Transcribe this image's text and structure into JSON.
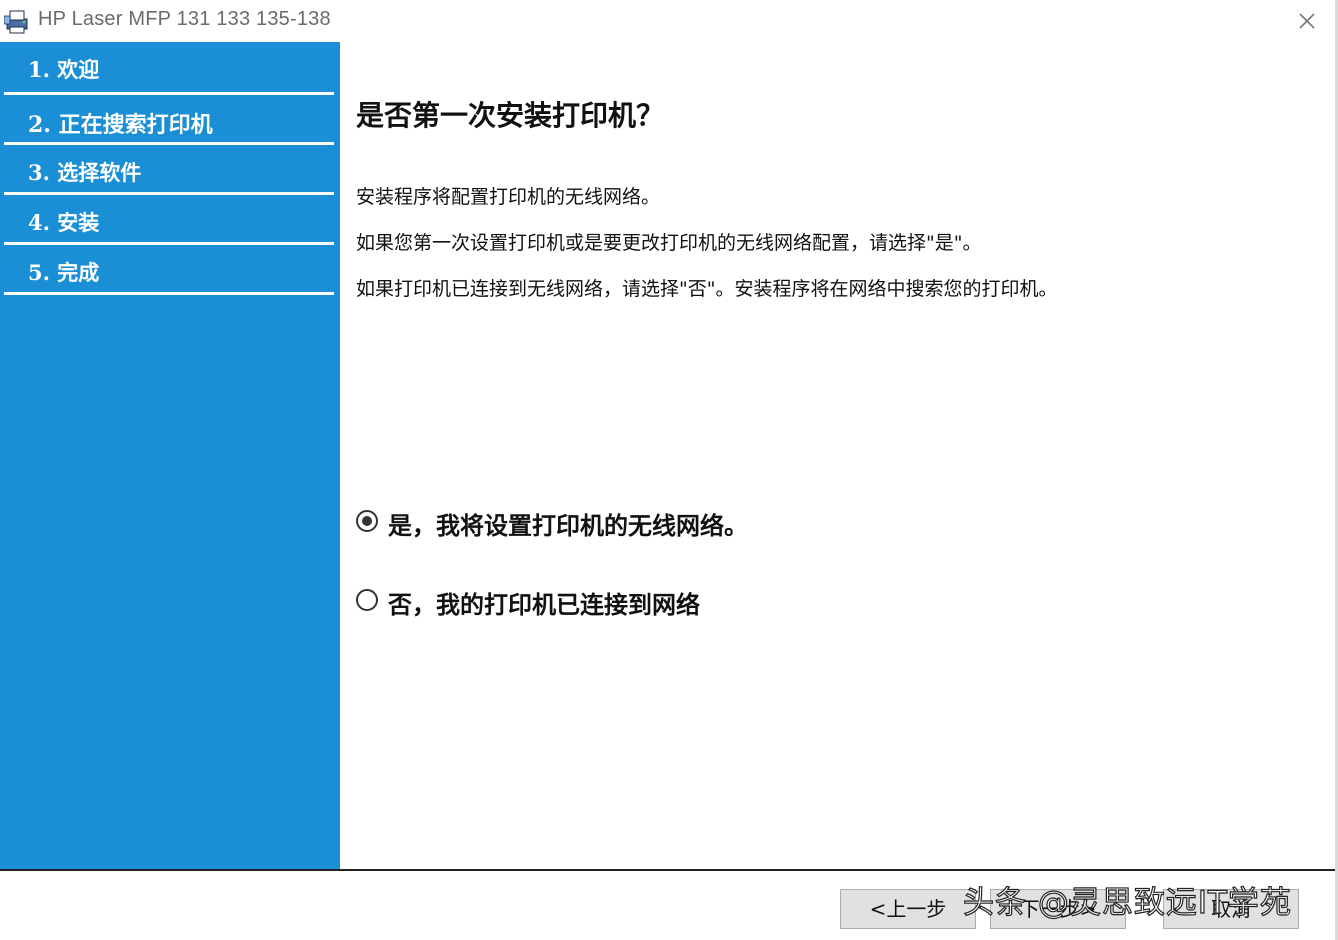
{
  "window": {
    "title": "HP Laser MFP 131 133 135-138"
  },
  "sidebar": {
    "steps": [
      {
        "label": "1. 欢迎"
      },
      {
        "label": "2. 正在搜索打印机"
      },
      {
        "label": "3. 选择软件"
      },
      {
        "label": "4. 安装"
      },
      {
        "label": "5. 完成"
      }
    ],
    "active_index": 1
  },
  "main": {
    "heading": "是否第一次安装打印机？",
    "paragraphs": [
      "安装程序将配置打印机的无线网络。",
      "如果您第一次设置打印机或是要更改打印机的无线网络配置，请选择\"是\"。",
      "如果打印机已连接到无线网络，请选择\"否\"。安装程序将在网络中搜索您的打印机。"
    ],
    "options": [
      {
        "label": "是，我将设置打印机的无线网络。",
        "selected": true
      },
      {
        "label": "否，我的打印机已连接到网络",
        "selected": false
      }
    ]
  },
  "footer": {
    "back_label": "<上一步",
    "next_label": "下一步>",
    "cancel_label": "取消",
    "watermark": "头条 @灵思致远IT学苑"
  },
  "colors": {
    "sidebar_bg": "#1a8fd6",
    "sidebar_text": "#ffffff"
  },
  "icons": {
    "app": "printer-setup-icon",
    "close": "close-icon"
  }
}
